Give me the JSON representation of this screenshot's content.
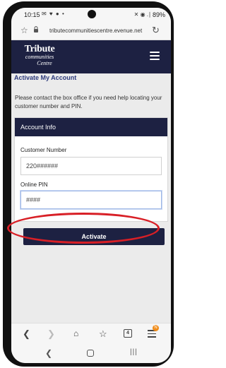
{
  "status_bar": {
    "time": "10:15",
    "left_icons": "✉ ♥ ● •",
    "right_icons": "✕ ◉ .∣",
    "battery": "89%"
  },
  "browser": {
    "url": "tributecommunitiescentre.evenue.net"
  },
  "header": {
    "logo_line1": "Tribute",
    "logo_line2": "communities",
    "logo_line3": "Centre"
  },
  "page": {
    "heading": "Activate My Account",
    "help_text": "Please contact the box office if you need help locating your customer number and PIN.",
    "panel_title": "Account Info",
    "customer_number_label": "Customer Number",
    "customer_number_value": "220######",
    "pin_label": "Online PIN",
    "pin_value": "####",
    "activate_label": "Activate"
  },
  "toolbar": {
    "tab_count": "4",
    "badge": "N"
  },
  "colors": {
    "brand_navy": "#1d2142",
    "highlight_red": "#d81f26",
    "link_blue": "#2d3a7c"
  }
}
